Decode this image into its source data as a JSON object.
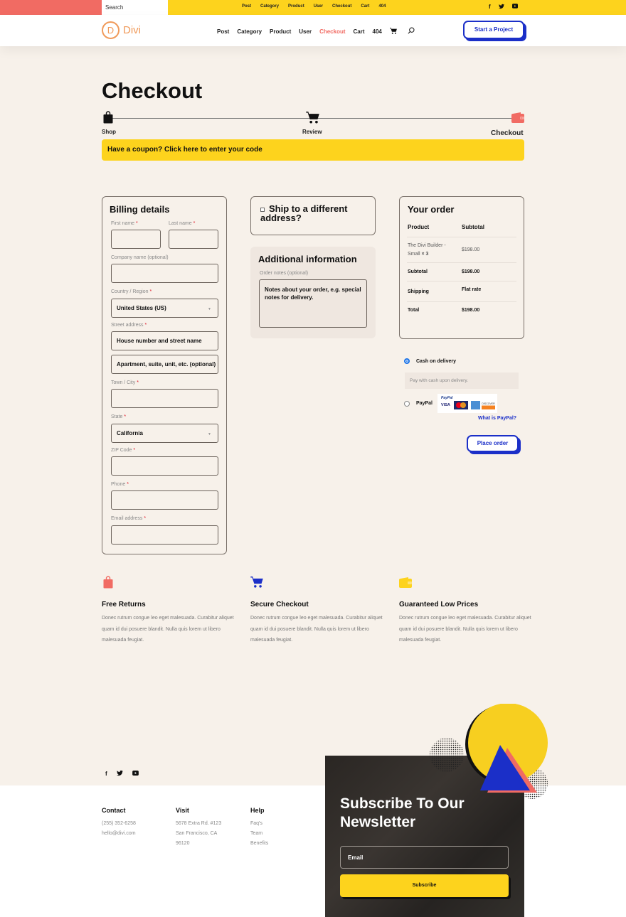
{
  "topbar": {
    "search_placeholder": "Search",
    "links": [
      "Post",
      "Category",
      "Product",
      "User",
      "Checkout",
      "Cart",
      "404"
    ],
    "social": [
      "facebook-icon",
      "twitter-icon",
      "youtube-icon"
    ]
  },
  "nav": {
    "logo_letter": "D",
    "logo_text": "Divi",
    "items": [
      "Post",
      "Category",
      "Product",
      "User",
      "Checkout",
      "Cart",
      "404"
    ],
    "active": "Checkout",
    "cta": "Start a Project",
    "colors": {
      "accent": "#f16b63",
      "brand": "#f09a5a",
      "blue": "#1b2fc8",
      "yellow": "#fdd31d"
    }
  },
  "page": {
    "title": "Checkout",
    "steps": [
      {
        "label": "Shop",
        "icon": "shopping-bag-icon"
      },
      {
        "label": "Review",
        "icon": "cart-icon"
      },
      {
        "label": "Checkout",
        "icon": "wallet-icon"
      }
    ],
    "coupon": "Have a coupon? Click here to enter your code"
  },
  "billing": {
    "title": "Billing details",
    "fields": {
      "first_name": "First name",
      "last_name": "Last name",
      "company": "Company name (optional)",
      "country": "Country / Region",
      "country_value": "United States (US)",
      "street": "Street address",
      "street_ph1": "House number and street name",
      "street_ph2": "Apartment, suite, unit, etc. (optional)",
      "city": "Town / City",
      "state": "State",
      "state_value": "California",
      "zip": "ZIP Code",
      "phone": "Phone",
      "email": "Email address"
    },
    "required_mark": "*"
  },
  "shipping": {
    "label": "Ship to a different address?"
  },
  "additional": {
    "title": "Additional information",
    "notes_label": "Order notes (optional)",
    "notes_placeholder": "Notes about your order, e.g. special notes for delivery."
  },
  "order": {
    "title": "Your order",
    "col_product": "Product",
    "col_subtotal": "Subtotal",
    "item_name": "The Divi Builder - Small",
    "item_qty": "× 3",
    "item_price": "$198.00",
    "subtotal_label": "Subtotal",
    "subtotal_value": "$198.00",
    "shipping_label": "Shipping",
    "shipping_value": "Flat rate",
    "total_label": "Total",
    "total_value": "$198.00"
  },
  "payment": {
    "cod_label": "Cash on delivery",
    "cod_desc": "Pay with cash upon delivery.",
    "paypal_label": "PayPal",
    "paypal_logo_text": "PayPal",
    "cards": [
      "VISA",
      "MasterCard",
      "AMEX",
      "DISCOVER"
    ],
    "what_is": "What is PayPal?",
    "place_order": "Place order"
  },
  "features": [
    {
      "title": "Free Returns",
      "icon": "shopping-bag-icon",
      "color": "#f16b63",
      "text": "Donec rutrum congue leo eget malesuada. Curabitur aliquet quam id dui posuere blandit. Nulla quis lorem ut libero malesuada feugiat."
    },
    {
      "title": "Secure Checkout",
      "icon": "cart-icon",
      "color": "#1b2fc8",
      "text": "Donec rutrum congue leo eget malesuada. Curabitur aliquet quam id dui posuere blandit. Nulla quis lorem ut libero malesuada feugiat."
    },
    {
      "title": "Guaranteed Low Prices",
      "icon": "wallet-icon",
      "color": "#fdd31d",
      "text": "Donec rutrum congue leo eget malesuada. Curabitur aliquet quam id dui posuere blandit. Nulla quis lorem ut libero malesuada feugiat."
    }
  ],
  "footer": {
    "social": [
      "facebook-icon",
      "twitter-icon",
      "youtube-icon"
    ],
    "contact": {
      "title": "Contact",
      "lines": [
        "(255) 352-6258",
        "hello@divi.com"
      ]
    },
    "visit": {
      "title": "Visit",
      "lines": [
        "5678 Extra Rd. #123",
        "San Francisco, CA",
        "96120"
      ]
    },
    "help": {
      "title": "Help",
      "lines": [
        "Faq's",
        "Team",
        "Benefits"
      ]
    }
  },
  "newsletter": {
    "title": "Subscribe To Our Newsletter",
    "email_placeholder": "Email",
    "button": "Subscribe"
  }
}
